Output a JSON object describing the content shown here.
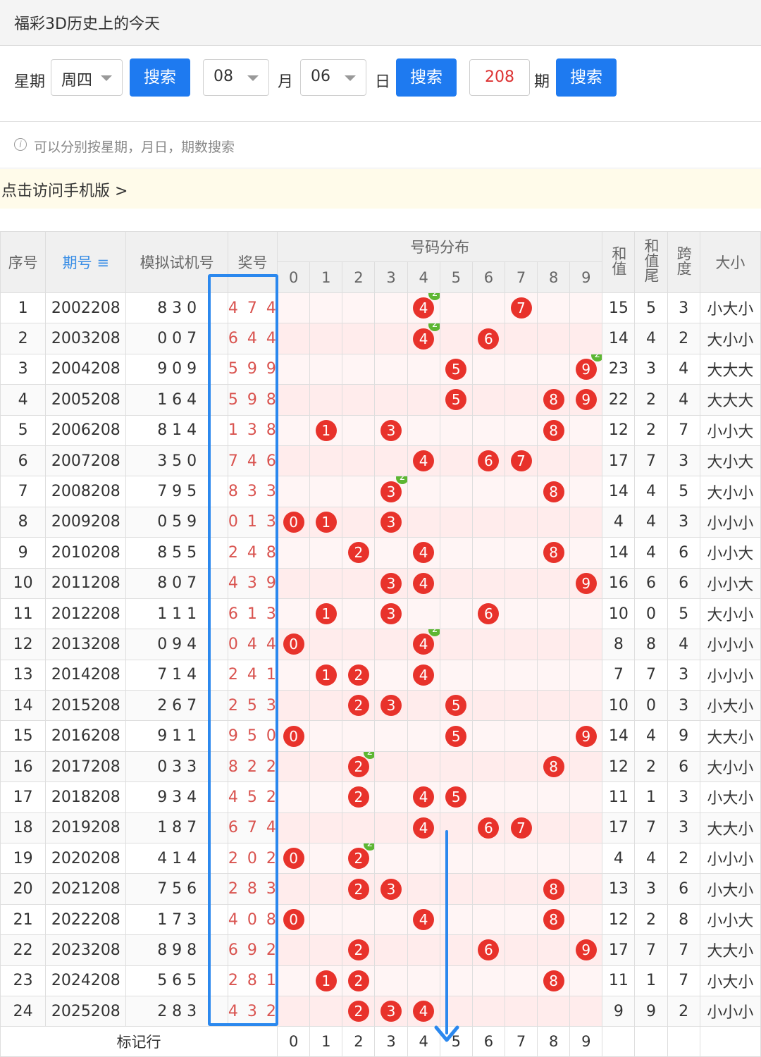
{
  "header": {
    "title": "福彩3D历史上的今天"
  },
  "search": {
    "weekday_label": "星期",
    "weekday_value": "周四",
    "search_label": "搜索",
    "month_value": "08",
    "month_label": "月",
    "day_value": "06",
    "day_label": "日",
    "period_value": "208",
    "period_label": "期"
  },
  "hint": {
    "icon": "info-icon",
    "text": "可以分别按星期，月日，期数搜索"
  },
  "mobile_link": {
    "text": "点击访问手机版 >"
  },
  "table": {
    "headers": {
      "seq": "序号",
      "issue": "期号",
      "issue_sort_icon": "sort-icon",
      "trial": "模拟试机号",
      "win": "奖号",
      "dist": "号码分布",
      "sum": "和值",
      "sum_tail": "和值尾",
      "span": "跨度",
      "size": "大小"
    },
    "digits": [
      "0",
      "1",
      "2",
      "3",
      "4",
      "5",
      "6",
      "7",
      "8",
      "9"
    ],
    "footer_label": "标记行",
    "rows": [
      {
        "seq": "1",
        "issue": "2002208",
        "trial": "8 3 0",
        "win": "4 7 4",
        "sum": "15",
        "tail": "5",
        "span": "3",
        "size": "小大小"
      },
      {
        "seq": "2",
        "issue": "2003208",
        "trial": "0 0 7",
        "win": "6 4 4",
        "sum": "14",
        "tail": "4",
        "span": "2",
        "size": "大小小"
      },
      {
        "seq": "3",
        "issue": "2004208",
        "trial": "9 0 9",
        "win": "5 9 9",
        "sum": "23",
        "tail": "3",
        "span": "4",
        "size": "大大大"
      },
      {
        "seq": "4",
        "issue": "2005208",
        "trial": "1 6 4",
        "win": "5 9 8",
        "sum": "22",
        "tail": "2",
        "span": "4",
        "size": "大大大"
      },
      {
        "seq": "5",
        "issue": "2006208",
        "trial": "8 1 4",
        "win": "1 3 8",
        "sum": "12",
        "tail": "2",
        "span": "7",
        "size": "小小大"
      },
      {
        "seq": "6",
        "issue": "2007208",
        "trial": "3 5 0",
        "win": "7 4 6",
        "sum": "17",
        "tail": "7",
        "span": "3",
        "size": "大小大"
      },
      {
        "seq": "7",
        "issue": "2008208",
        "trial": "7 9 5",
        "win": "8 3 3",
        "sum": "14",
        "tail": "4",
        "span": "5",
        "size": "大小小"
      },
      {
        "seq": "8",
        "issue": "2009208",
        "trial": "0 5 9",
        "win": "0 1 3",
        "sum": "4",
        "tail": "4",
        "span": "3",
        "size": "小小小"
      },
      {
        "seq": "9",
        "issue": "2010208",
        "trial": "8 5 5",
        "win": "2 4 8",
        "sum": "14",
        "tail": "4",
        "span": "6",
        "size": "小小大"
      },
      {
        "seq": "10",
        "issue": "2011208",
        "trial": "8 0 7",
        "win": "4 3 9",
        "sum": "16",
        "tail": "6",
        "span": "6",
        "size": "小小大"
      },
      {
        "seq": "11",
        "issue": "2012208",
        "trial": "1 1 1",
        "win": "6 1 3",
        "sum": "10",
        "tail": "0",
        "span": "5",
        "size": "大小小"
      },
      {
        "seq": "12",
        "issue": "2013208",
        "trial": "0 9 4",
        "win": "0 4 4",
        "sum": "8",
        "tail": "8",
        "span": "4",
        "size": "小小小"
      },
      {
        "seq": "13",
        "issue": "2014208",
        "trial": "7 1 4",
        "win": "2 4 1",
        "sum": "7",
        "tail": "7",
        "span": "3",
        "size": "小小小"
      },
      {
        "seq": "14",
        "issue": "2015208",
        "trial": "2 6 7",
        "win": "2 5 3",
        "sum": "10",
        "tail": "0",
        "span": "3",
        "size": "小大小"
      },
      {
        "seq": "15",
        "issue": "2016208",
        "trial": "9 1 1",
        "win": "9 5 0",
        "sum": "14",
        "tail": "4",
        "span": "9",
        "size": "大大小"
      },
      {
        "seq": "16",
        "issue": "2017208",
        "trial": "0 3 3",
        "win": "8 2 2",
        "sum": "12",
        "tail": "2",
        "span": "6",
        "size": "大小小"
      },
      {
        "seq": "17",
        "issue": "2018208",
        "trial": "9 3 4",
        "win": "4 5 2",
        "sum": "11",
        "tail": "1",
        "span": "3",
        "size": "小大小"
      },
      {
        "seq": "18",
        "issue": "2019208",
        "trial": "1 8 7",
        "win": "6 7 4",
        "sum": "17",
        "tail": "7",
        "span": "3",
        "size": "大大小"
      },
      {
        "seq": "19",
        "issue": "2020208",
        "trial": "4 1 4",
        "win": "2 0 2",
        "sum": "4",
        "tail": "4",
        "span": "2",
        "size": "小小小"
      },
      {
        "seq": "20",
        "issue": "2021208",
        "trial": "7 5 6",
        "win": "2 8 3",
        "sum": "13",
        "tail": "3",
        "span": "6",
        "size": "小大小"
      },
      {
        "seq": "21",
        "issue": "2022208",
        "trial": "1 7 3",
        "win": "4 0 8",
        "sum": "12",
        "tail": "2",
        "span": "8",
        "size": "小小大"
      },
      {
        "seq": "22",
        "issue": "2023208",
        "trial": "8 9 8",
        "win": "6 9 2",
        "sum": "17",
        "tail": "7",
        "span": "7",
        "size": "大大小"
      },
      {
        "seq": "23",
        "issue": "2024208",
        "trial": "5 6 5",
        "win": "2 8 1",
        "sum": "11",
        "tail": "1",
        "span": "7",
        "size": "小大小"
      },
      {
        "seq": "24",
        "issue": "2025208",
        "trial": "2 8 3",
        "win": "4 3 2",
        "sum": "9",
        "tail": "9",
        "span": "2",
        "size": "小小小"
      }
    ]
  },
  "colors": {
    "accent": "#1e7af0",
    "ball": "#e8322b",
    "dup_badge": "#5db632",
    "annotation": "#2b88ee"
  }
}
